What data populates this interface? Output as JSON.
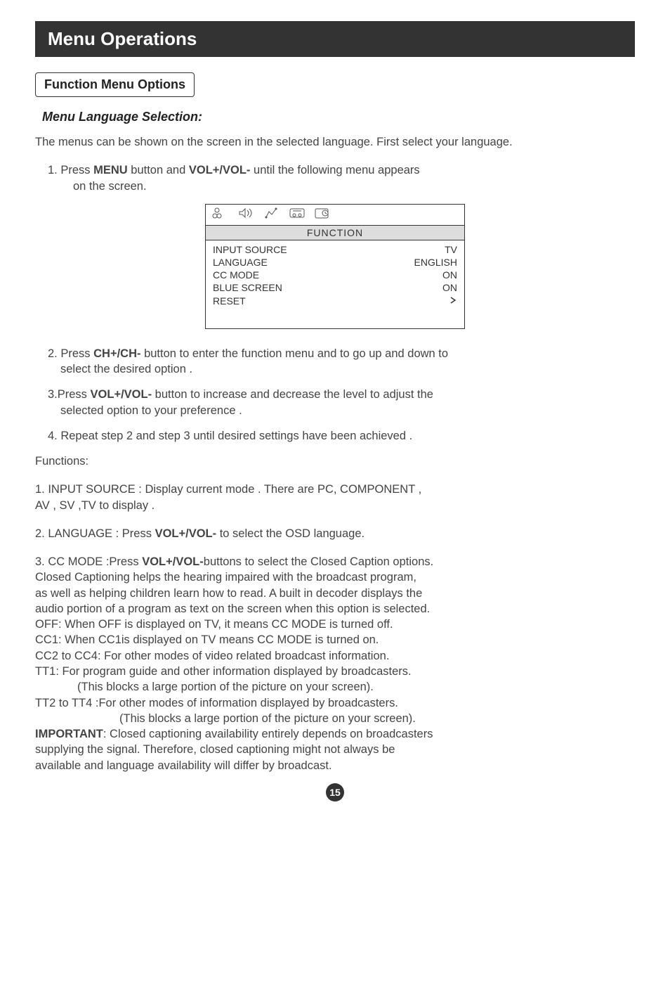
{
  "title": "Menu Operations",
  "section": "Function Menu Options",
  "subheading": "Menu Language Selection:",
  "intro": "The menus can be shown on the screen in the selected language. First select your language.",
  "step1_prefix": "1. Press ",
  "step1_bold1": "MENU",
  "step1_mid": " button and ",
  "step1_bold2": "VOL+/VOL-",
  "step1_suffix": " until the following menu appears",
  "step1_line2": "on the screen.",
  "menu": {
    "header": "FUNCTION",
    "rows": [
      {
        "label": "INPUT SOURCE",
        "value": "TV"
      },
      {
        "label": "LANGUAGE",
        "value": "ENGLISH"
      },
      {
        "label": "CC MODE",
        "value": "ON"
      },
      {
        "label": "BLUE SCREEN",
        "value": "ON"
      },
      {
        "label": "RESET",
        "value": ""
      }
    ]
  },
  "step2_prefix": "2. Press ",
  "step2_bold": "CH+/CH-",
  "step2_suffix": " button to enter the function menu and to go up and down to",
  "step2_line2": "select the desired option .",
  "step3_prefix": "3.Press ",
  "step3_bold": "VOL+/VOL-",
  "step3_suffix": " button to increase and decrease the level to adjust the",
  "step3_line2": "selected option to your preference .",
  "step4": "4. Repeat step 2 and step 3 until desired settings have been achieved .",
  "functions_label": "Functions:",
  "func1_line1": "1. INPUT SOURCE : Display current mode . There are PC, COMPONENT ,",
  "func1_line2": "AV , SV ,TV  to display .",
  "func2_prefix": "2. LANGUAGE : Press ",
  "func2_bold": "VOL+/VOL-",
  "func2_suffix": " to select the OSD language.",
  "func3_prefix": "3. CC MODE :Press ",
  "func3_bold": "VOL+/VOL-",
  "func3_suffix": "buttons to select the Closed Caption options.",
  "func3_body1": "Closed Captioning helps the hearing impaired with the broadcast program,",
  "func3_body2": "as well as helping children learn how to read.  A built in decoder displays the",
  "func3_body3": "audio portion of a program as text on the screen when this  option is selected.",
  "func3_off": "OFF:  When OFF is displayed on TV, it means CC MODE is turned off.",
  "func3_cc1": "CC1:  When CC1is displayed on TV means CC MODE is turned on.",
  "func3_cc2": "CC2 to CC4: For other modes of video related broadcast information.",
  "func3_tt1": "TT1: For program guide and other information displayed by broadcasters.",
  "func3_tt1_note": "(This blocks a large portion of the picture on your screen).",
  "func3_tt2": "TT2 to TT4 :For other modes of information displayed by broadcasters.",
  "func3_tt2_note": "(This blocks a large portion of the picture on your screen).",
  "important_bold": "IMPORTANT",
  "important_suffix": ": Closed captioning availability entirely depends on broadcasters",
  "important_line2": "supplying the signal. Therefore, closed captioning might not always be",
  "important_line3": "available and language availability will differ by broadcast.",
  "page_number": "15"
}
